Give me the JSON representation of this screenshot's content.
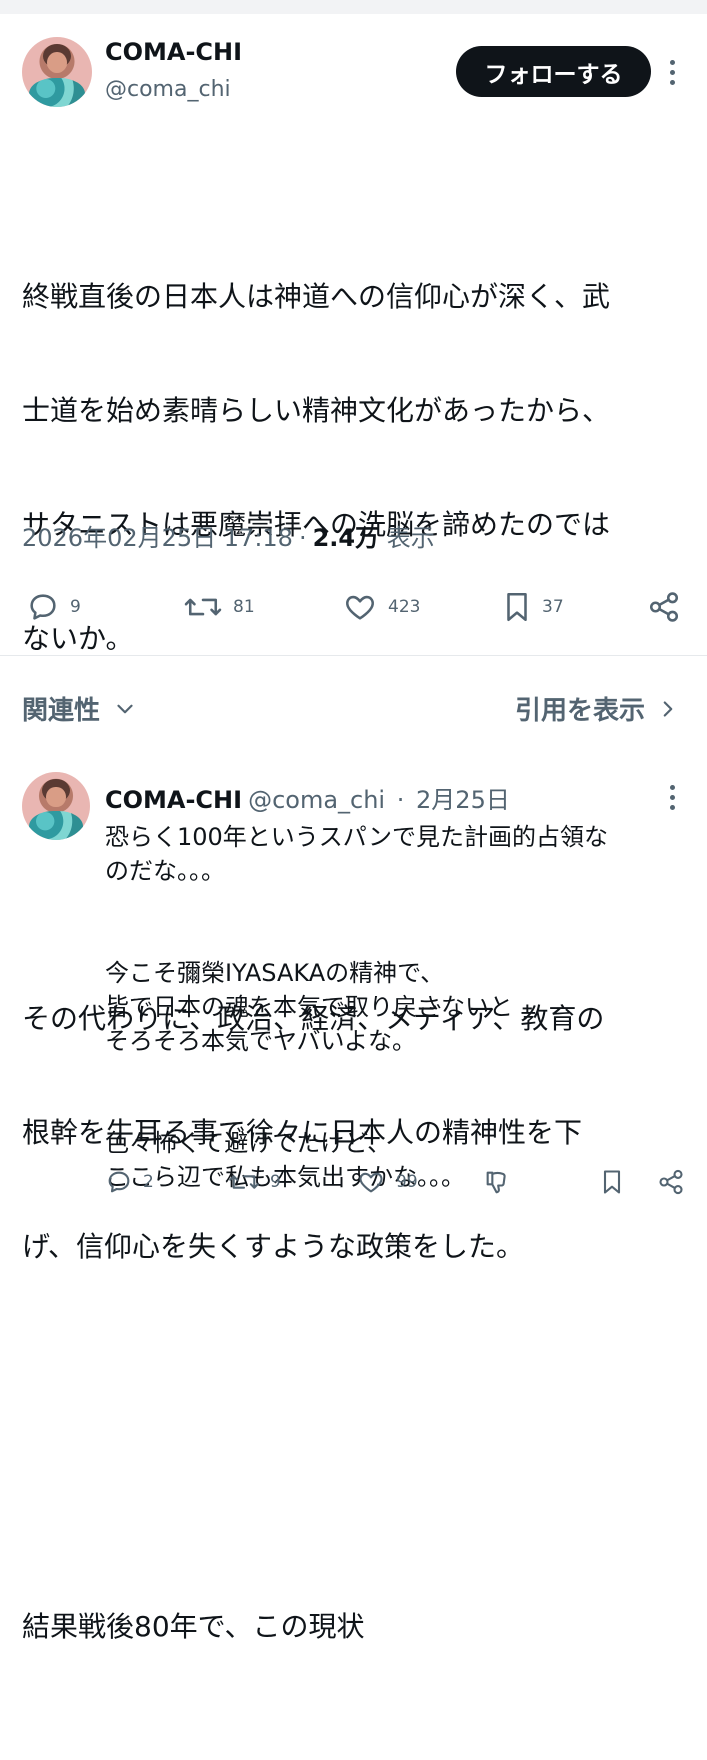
{
  "post": {
    "author_name": "COMA-CHI",
    "author_handle": "@coma_chi",
    "follow_label": "フォローする",
    "paragraphs": [
      [
        "終戦直後の日本人は神道への信仰心が深く、武",
        "士道を始め素晴らしい精神文化があったから、",
        "サタニストは悪魔崇拝への洗脳を諦めたのでは",
        "ないか。"
      ],
      [
        "その代わりに、政治、経済、メディア、教育の",
        "根幹を牛耳る事で徐々に日本人の精神性を下",
        "げ、信仰心を失くすような政策をした。"
      ],
      [
        "結果戦後80年で、この現状"
      ]
    ],
    "timestamp": "2026年02月25日 17:18",
    "separator": "·",
    "views": "2.4万",
    "views_label": "表示",
    "stats": {
      "replies": "9",
      "reposts": "81",
      "likes": "423",
      "bookmarks": "37"
    }
  },
  "section": {
    "related_label": "関連性",
    "quotes_label": "引用を表示"
  },
  "reply": {
    "author_name": "COMA-CHI",
    "author_handle": "@coma_chi",
    "separator": "·",
    "date": "2月25日",
    "paragraphs": [
      [
        "恐らく100年というスパンで見た計画的占領な",
        "のだな。。。"
      ],
      [
        "今こそ彌榮IYASAKAの精神で、",
        "皆で日本の魂を本気で取り戻さないと",
        "そろそろ本気でヤバいよな。"
      ],
      [
        "色々怖くて避けてたけど、",
        "ここら辺で私も本気出すかな。。。"
      ]
    ],
    "stats": {
      "replies": "2",
      "reposts": "9",
      "likes": "99"
    }
  },
  "icons": [
    "avatar",
    "more-vertical-icon",
    "reply-icon",
    "repost-icon",
    "like-icon",
    "bookmark-icon",
    "share-icon",
    "chevron-down-icon",
    "chevron-right-icon",
    "dislike-icon"
  ],
  "colors": {
    "text": "#0f1419",
    "muted": "#536471",
    "button_bg": "#0f1419",
    "divider": "#e6e9ec"
  }
}
